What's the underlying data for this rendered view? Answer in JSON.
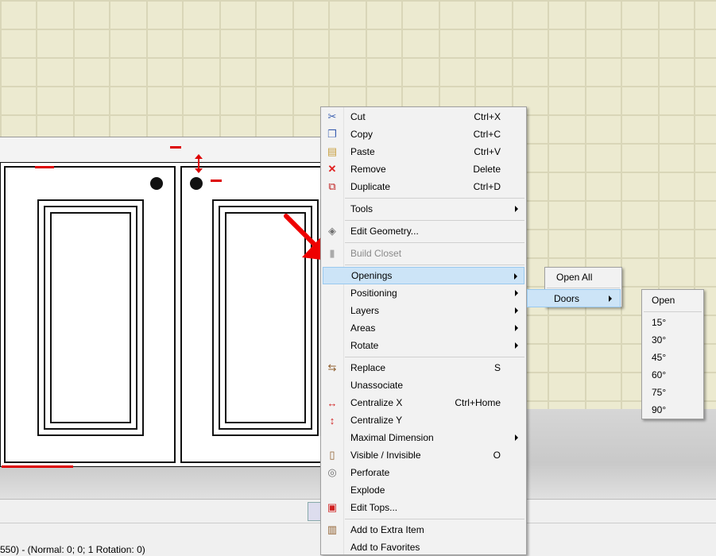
{
  "status": {
    "text": "550) - (Normal: 0; 0; 1 Rotation: 0)"
  },
  "context_menu": {
    "items": [
      {
        "label": "Cut",
        "shortcut": "Ctrl+X",
        "icon": "scissors-icon"
      },
      {
        "label": "Copy",
        "shortcut": "Ctrl+C",
        "icon": "copy-icon"
      },
      {
        "label": "Paste",
        "shortcut": "Ctrl+V",
        "icon": "paste-icon"
      },
      {
        "label": "Remove",
        "shortcut": "Delete",
        "icon": "remove-x-icon"
      },
      {
        "label": "Duplicate",
        "shortcut": "Ctrl+D",
        "icon": "duplicate-icon"
      },
      {
        "label": "Tools"
      },
      {
        "label": "Edit Geometry...",
        "icon": "edit-geometry-icon"
      },
      {
        "label": "Build Closet",
        "icon": "build-closet-icon"
      },
      {
        "label": "Openings"
      },
      {
        "label": "Positioning"
      },
      {
        "label": "Layers"
      },
      {
        "label": "Areas"
      },
      {
        "label": "Rotate"
      },
      {
        "label": "Replace",
        "shortcut": "S",
        "icon": "replace-icon"
      },
      {
        "label": "Unassociate"
      },
      {
        "label": "Centralize X",
        "shortcut": "Ctrl+Home",
        "icon": "centralize-x-icon"
      },
      {
        "label": "Centralize Y",
        "icon": "centralize-y-icon"
      },
      {
        "label": "Maximal Dimension"
      },
      {
        "label": "Visible / Invisible",
        "shortcut": "O",
        "icon": "visibility-icon"
      },
      {
        "label": "Perforate",
        "icon": "perforate-icon"
      },
      {
        "label": "Explode"
      },
      {
        "label": "Edit Tops...",
        "icon": "edit-tops-icon"
      },
      {
        "label": "Add to Extra Item",
        "icon": "add-extra-item-icon"
      },
      {
        "label": "Add to Favorites"
      }
    ]
  },
  "openings_submenu": {
    "open_all": "Open All",
    "doors": "Doors"
  },
  "doors_submenu": {
    "items": [
      "Open",
      "15°",
      "30°",
      "45°",
      "60°",
      "75°",
      "90°"
    ]
  }
}
